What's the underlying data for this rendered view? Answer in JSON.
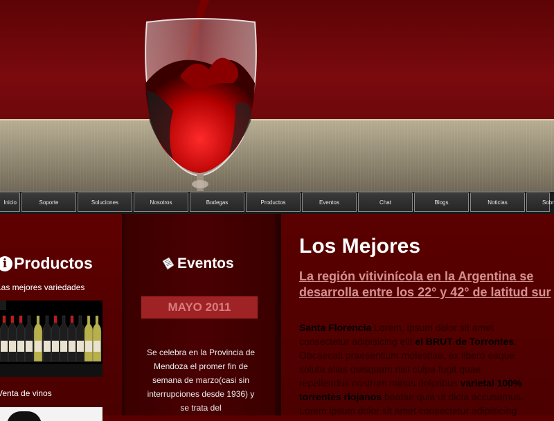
{
  "nav": {
    "items": [
      "Inicio",
      "Soporte",
      "Soluciones",
      "Nosotros",
      "Bodegas",
      "Productos",
      "Eventos",
      "Chat",
      "Blogs",
      "Noticias",
      "Sobre"
    ]
  },
  "colors": {
    "background": "#5a0000",
    "accent": "#9f2325",
    "nav": "#262626",
    "link": "#d69090"
  },
  "productos": {
    "title": "Productos",
    "subtitle": "Las mejores variedades",
    "subtitle2": "Venta de vinos"
  },
  "eventos": {
    "title": "Eventos",
    "month": "MAYO 2011",
    "text": "Se celebra en la Provincia de Mendoza el promer fin de semana de marzo(casi sin interrupciones desde 1936) y se trata del"
  },
  "main": {
    "title": "Los Mejores",
    "subtitle_line1": "La región vitivinícola en la Argentina se",
    "subtitle_line2": "desarrolla entre los 22° y 42° de latitud sur",
    "p_strong1": "Santa Florencia",
    "p_text1": " Lorem, ipsum dolor sit amet",
    "p_text2": "consectetur adipisicing elit ",
    "p_strong2": "el BRUT de Torrontes",
    "p_text3": ".",
    "p_text4": "Obcaecati praesentium molestiae, ex libero eaque",
    "p_text5": "soluta alias quisquam nisi culpa fugit quae",
    "p_text6": "repellendus nostrum minus doloribus ",
    "p_strong3": "varietal 100%",
    "p_strong4": "torrentes riojanos",
    "p_text7": " beatae quia ut dicta accusamus.",
    "p_text8": "Lorem ipsum dolor sit amet consectetur adipisicing"
  }
}
